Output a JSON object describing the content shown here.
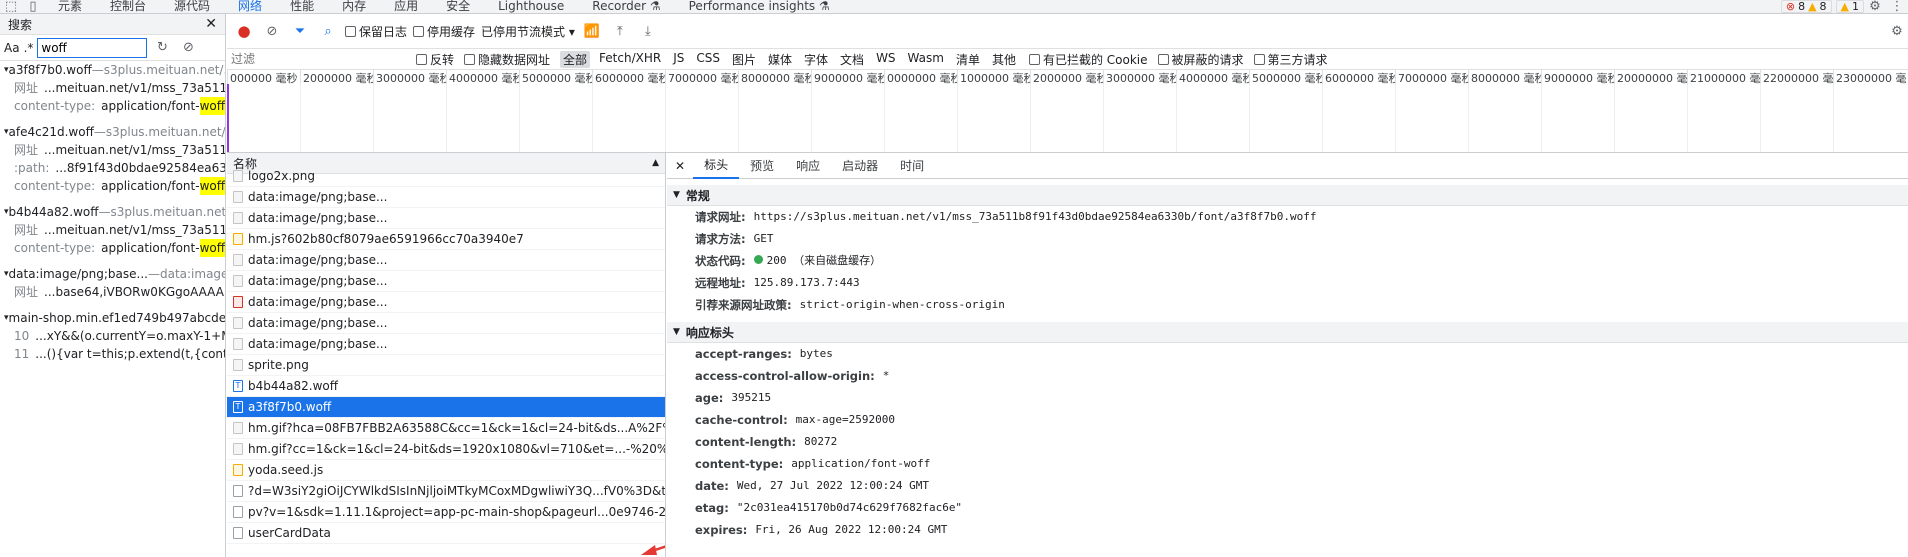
{
  "toptabs": [
    "元素",
    "控制台",
    "源代码",
    "网络",
    "性能",
    "内存",
    "应用",
    "安全",
    "Lighthouse",
    "Recorder ⚗",
    "Performance insights ⚗"
  ],
  "badges": {
    "errors": "8",
    "warnings": "8",
    "info": "1"
  },
  "search": {
    "title": "搜索",
    "aa": "Aa",
    "regex": ".*",
    "query": "woff",
    "results": [
      {
        "name": "a3f8f7b0.woff",
        "host": "s3plus.meituan.net/...",
        "lines": [
          {
            "k": "网址",
            "v": "...meituan.net/v1/mss_73a511b...",
            "hl": ""
          },
          {
            "k": "content-type:",
            "v": "application/font-",
            "hl": "woff"
          }
        ]
      },
      {
        "name": "afe4c21d.woff",
        "host": "s3plus.meituan.net/...",
        "lines": [
          {
            "k": "网址",
            "v": "...meituan.net/v1/mss_73a511b...",
            "hl": ""
          },
          {
            "k": ":path:",
            "v": "...8f91f43d0bdae92584ea6330...",
            "hl": ""
          },
          {
            "k": "content-type:",
            "v": "application/font-",
            "hl": "woff"
          }
        ]
      },
      {
        "name": "b4b44a82.woff",
        "host": "s3plus.meituan.net...",
        "lines": [
          {
            "k": "网址",
            "v": "...meituan.net/v1/mss_73a511b...",
            "hl": ""
          },
          {
            "k": "content-type:",
            "v": "application/font-",
            "hl": "woff"
          }
        ]
      },
      {
        "name": "data:image/png;base...",
        "host": "data:image...",
        "lines": [
          {
            "k": "网址",
            "v": "...base64,iVBORw0KGgoAAAAN...",
            "hl": ""
          }
        ]
      },
      {
        "name": "main-shop.min.ef1ed749b497abcde0...",
        "host": "",
        "lines": [
          {
            "k": "10",
            "v": "...xY&&(o.currentY=o.maxY-1+M...",
            "hl": ""
          },
          {
            "k": "11",
            "v": "...(){var t=this;p.extend(t,{controll...",
            "hl": ""
          }
        ]
      }
    ]
  },
  "toolbar": {
    "preserve_log": "保留日志",
    "disable_cache": "停用缓存",
    "throttle": "已停用节流模式"
  },
  "filter": {
    "placeholder": "过滤",
    "invert": "反转",
    "hide_data": "隐藏数据网址",
    "types": [
      "全部",
      "Fetch/XHR",
      "JS",
      "CSS",
      "图片",
      "媒体",
      "字体",
      "文档",
      "WS",
      "Wasm",
      "清单",
      "其他"
    ],
    "blocked_cookies": "有已拦截的 Cookie",
    "blocked_requests": "被屏蔽的请求",
    "third_party": "第三方请求"
  },
  "timeline": {
    "ticks": [
      "000000 毫秒",
      "2000000 毫秒",
      "3000000 毫秒",
      "4000000 毫秒",
      "5000000 毫秒",
      "6000000 毫秒",
      "7000000 毫秒",
      "8000000 毫秒",
      "9000000 毫秒",
      "0000000 毫秒",
      "1000000 毫秒",
      "2000000 毫秒",
      "3000000 毫秒",
      "4000000 毫秒",
      "5000000 毫秒",
      "6000000 毫秒",
      "7000000 毫秒",
      "8000000 毫秒",
      "9000000 毫秒",
      "20000000 毫秒",
      "21000000 毫秒",
      "22000000 毫秒",
      "23000000 毫秒"
    ]
  },
  "requests": {
    "header": "名称",
    "items": [
      {
        "name": "logo2x.png",
        "icon": "img"
      },
      {
        "name": "data:image/png;base...",
        "icon": "img"
      },
      {
        "name": "data:image/png;base...",
        "icon": "img"
      },
      {
        "name": "hm.js?602b80cf8079ae6591966cc70a3940e7",
        "icon": "js"
      },
      {
        "name": "data:image/png;base...",
        "icon": "img"
      },
      {
        "name": "data:image/png;base...",
        "icon": "img"
      },
      {
        "name": "data:image/png;base...",
        "icon": "red"
      },
      {
        "name": "data:image/png;base...",
        "icon": "img"
      },
      {
        "name": "data:image/png;base...",
        "icon": "img"
      },
      {
        "name": "sprite.png",
        "icon": "img"
      },
      {
        "name": "b4b44a82.woff",
        "icon": "font"
      },
      {
        "name": "a3f8f7b0.woff",
        "icon": "font"
      },
      {
        "name": "hm.gif?hca=08FB7FBB2A63588C&cc=1&ck=1&cl=24-bit&ds...A%2F%2Fww",
        "icon": "img"
      },
      {
        "name": "hm.gif?cc=1&ck=1&cl=24-bit&ds=1920x1080&vl=710&et=...-%20%E5%A4",
        "icon": "img"
      },
      {
        "name": "yoda.seed.js",
        "icon": "js"
      },
      {
        "name": "?d=W3siY2giOiJCYWlkdSIsInNjljoiMTkyMCoxMDgwliwiY3Q...fV0%3D&t=1&",
        "icon": "doc"
      },
      {
        "name": "pv?v=1&sdk=1.11.1&project=app-pc-main-shop&pageurl...0e9746-26021a",
        "icon": "doc"
      },
      {
        "name": "userCardData",
        "icon": "doc"
      }
    ]
  },
  "detail": {
    "tabs": [
      "标头",
      "预览",
      "响应",
      "启动器",
      "时间"
    ],
    "general_title": "常规",
    "general": [
      {
        "k": "请求网址:",
        "v": "https://s3plus.meituan.net/v1/mss_73a511b8f91f43d0bdae92584ea6330b/font/a3f8f7b0.woff"
      },
      {
        "k": "请求方法:",
        "v": "GET"
      },
      {
        "k": "状态代码:",
        "v": "200  （来自磁盘缓存）"
      },
      {
        "k": "远程地址:",
        "v": "125.89.173.7:443"
      },
      {
        "k": "引荐来源网址政策:",
        "v": "strict-origin-when-cross-origin"
      }
    ],
    "response_title": "响应标头",
    "response": [
      {
        "k": "accept-ranges:",
        "v": "bytes"
      },
      {
        "k": "access-control-allow-origin:",
        "v": "*"
      },
      {
        "k": "age:",
        "v": "395215"
      },
      {
        "k": "cache-control:",
        "v": "max-age=2592000"
      },
      {
        "k": "content-length:",
        "v": "80272"
      },
      {
        "k": "content-type:",
        "v": "application/font-woff"
      },
      {
        "k": "date:",
        "v": "Wed, 27 Jul 2022 12:00:24 GMT"
      },
      {
        "k": "etag:",
        "v": "\"2c031ea415170b0d74c629f7682fac6e\""
      },
      {
        "k": "expires:",
        "v": "Fri, 26 Aug 2022 12:00:24 GMT"
      }
    ]
  }
}
